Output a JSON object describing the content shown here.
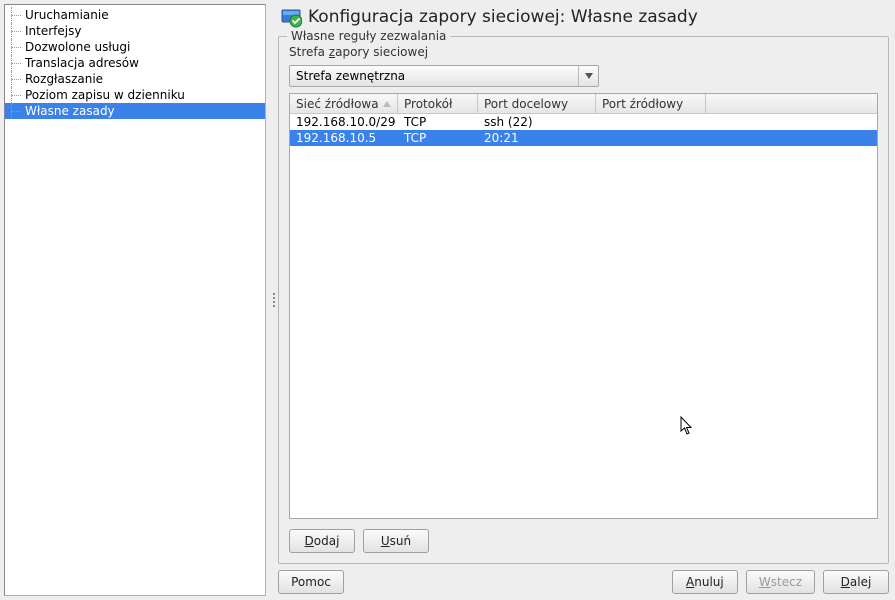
{
  "sidebar": {
    "items": [
      {
        "label": "Uruchamianie",
        "selected": false
      },
      {
        "label": "Interfejsy",
        "selected": false
      },
      {
        "label": "Dozwolone usługi",
        "selected": false
      },
      {
        "label": "Translacja adresów",
        "selected": false
      },
      {
        "label": "Rozgłaszanie",
        "selected": false
      },
      {
        "label": "Poziom zapisu w dzienniku",
        "selected": false
      },
      {
        "label": "Własne zasady",
        "selected": true
      }
    ]
  },
  "header": {
    "title": "Konfiguracja zapory sieciowej: Własne zasady"
  },
  "fieldset": {
    "legend": "Własne reguły zezwalania",
    "zone_label_pre": "Strefa ",
    "zone_label_mn": "z",
    "zone_label_post": "apory sieciowej",
    "zone_value": "Strefa zewnętrzna"
  },
  "table": {
    "columns": {
      "source_net": "Sieć źródłowa",
      "protocol": "Protokół",
      "dst_port": "Port docelowy",
      "src_port": "Port źródłowy"
    },
    "rows": [
      {
        "source_net": "192.168.10.0/29",
        "protocol": "TCP",
        "dst_port": "ssh (22)",
        "src_port": "",
        "selected": false
      },
      {
        "source_net": "192.168.10.5",
        "protocol": "TCP",
        "dst_port": "20:21",
        "src_port": "",
        "selected": true
      }
    ]
  },
  "buttons": {
    "add_mn": "D",
    "add_post": "odaj",
    "del_mn": "U",
    "del_post": "suń",
    "help": "Pomoc",
    "cancel_mn": "A",
    "cancel_post": "nuluj",
    "back_mn": "W",
    "back_post": "stecz",
    "next_mn": "D",
    "next_post": "alej"
  }
}
